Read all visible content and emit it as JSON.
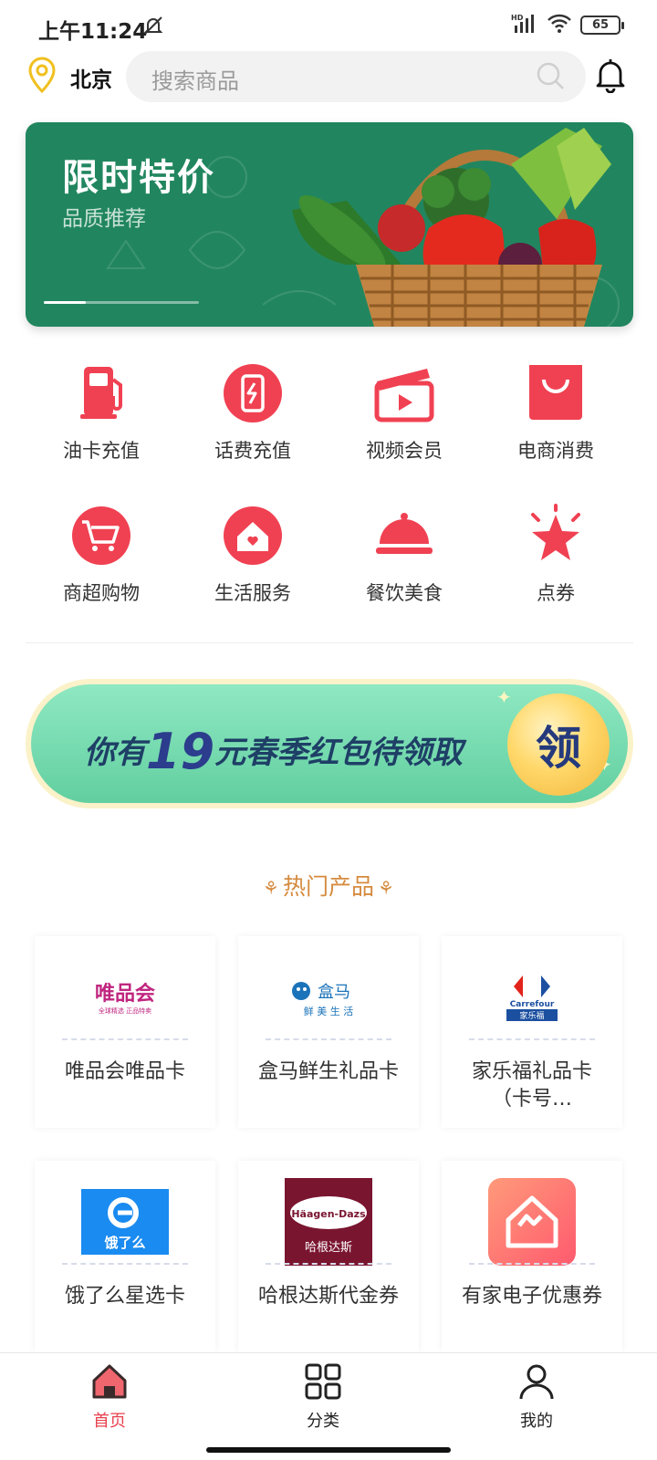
{
  "status": {
    "time": "上午11:24",
    "battery": "65"
  },
  "header": {
    "city": "北京",
    "search_placeholder": "搜索商品"
  },
  "banner": {
    "title": "限时特价",
    "subtitle": "品质推荐"
  },
  "categories": [
    {
      "label": "油卡充值",
      "icon": "fuel-pump-icon"
    },
    {
      "label": "话费充值",
      "icon": "phone-charge-icon"
    },
    {
      "label": "视频会员",
      "icon": "video-clapper-icon"
    },
    {
      "label": "电商消费",
      "icon": "shopping-bag-icon"
    },
    {
      "label": "商超购物",
      "icon": "shopping-cart-icon"
    },
    {
      "label": "生活服务",
      "icon": "home-service-icon"
    },
    {
      "label": "餐饮美食",
      "icon": "food-cloche-icon"
    },
    {
      "label": "点券",
      "icon": "star-icon"
    }
  ],
  "promo": {
    "text_before": "你有",
    "amount": "19",
    "text_after": "元春季红包待领取",
    "button": "领"
  },
  "section": {
    "title": "热门产品"
  },
  "products": [
    {
      "name": "唯品会唯品卡",
      "logo_text": "唯品会",
      "logo_sub": "全球精选 正品特卖"
    },
    {
      "name": "盒马鲜生礼品卡",
      "logo_text": "盒马",
      "logo_sub": "鲜 美 生 活"
    },
    {
      "name": "家乐福礼品卡（卡号…",
      "logo_text": "Carrefour",
      "logo_sub": "家乐福"
    },
    {
      "name": "饿了么星选卡",
      "logo_text": "饿了么"
    },
    {
      "name": "哈根达斯代金券",
      "logo_text": "Häagen-Dazs",
      "logo_sub": "哈根达斯"
    },
    {
      "name": "有家电子优惠券"
    }
  ],
  "nav": [
    {
      "label": "首页",
      "icon": "home-icon",
      "active": true
    },
    {
      "label": "分类",
      "icon": "grid-icon",
      "active": false
    },
    {
      "label": "我的",
      "icon": "user-icon",
      "active": false
    }
  ],
  "colors": {
    "accent_red": "#f04152",
    "banner_green": "#21865f",
    "section_orange": "#d58b3f"
  }
}
